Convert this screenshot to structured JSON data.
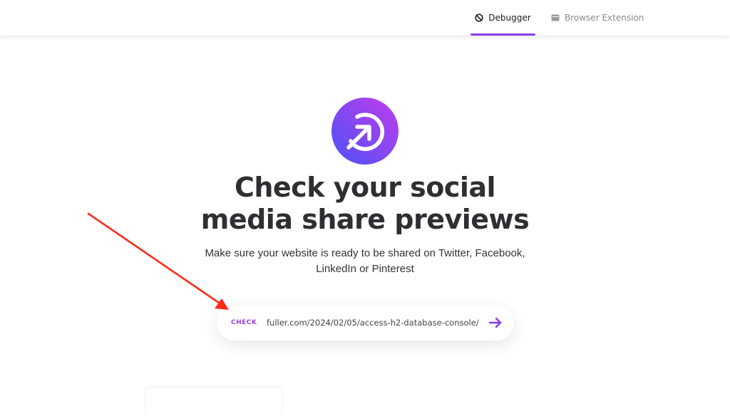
{
  "nav": {
    "tabs": [
      {
        "label": "Debugger",
        "icon": "ban-icon",
        "active": true
      },
      {
        "label": "Browser Extension",
        "icon": "browser-window-icon",
        "active": false
      }
    ]
  },
  "hero": {
    "logo_icon": "circle-arrow-logo",
    "title_line1": "Check your social",
    "title_line2": "media share previews",
    "subtitle_line1": "Make sure your website is ready to be shared on Twitter, Facebook,",
    "subtitle_line2": "LinkedIn or Pinterest"
  },
  "search": {
    "label": "CHECK",
    "value": "fuller.com/2024/02/05/access-h2-database-console/",
    "submit_icon": "arrow-right-icon"
  },
  "colors": {
    "accent": "#8b3cf0",
    "logo_gradient_start": "#5b4cf5",
    "logo_gradient_end": "#b63df0",
    "annotation_arrow": "#ff2a17"
  }
}
